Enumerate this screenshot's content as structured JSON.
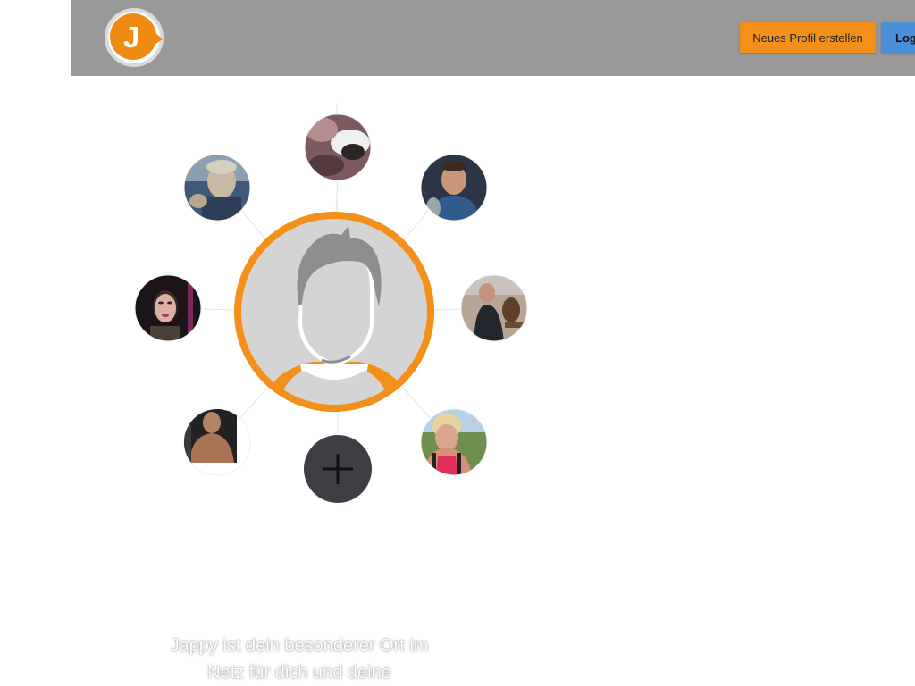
{
  "header": {
    "logo_letter": "J",
    "register_label": "Neues Profil erstellen",
    "login_label": "Log"
  },
  "network": {
    "center": {
      "icon": "user-silhouette-icon"
    },
    "add_button": {
      "icon": "plus-icon"
    },
    "profiles": [
      {
        "id": "top",
        "icon": "profile-photo"
      },
      {
        "id": "top-left",
        "icon": "profile-photo"
      },
      {
        "id": "top-right",
        "icon": "profile-photo"
      },
      {
        "id": "left",
        "icon": "profile-photo"
      },
      {
        "id": "right",
        "icon": "profile-photo"
      },
      {
        "id": "bottom-left",
        "icon": "profile-photo"
      },
      {
        "id": "bottom-right",
        "icon": "profile-photo"
      }
    ]
  },
  "tagline": {
    "line1": "Jappy ist dein besonderer Ort im",
    "line2": "Netz für dich und deine"
  },
  "colors": {
    "header_bg": "#999999",
    "accent_orange": "#f39019",
    "login_blue": "#4a90d9",
    "add_button_bg": "#3d3f45"
  }
}
